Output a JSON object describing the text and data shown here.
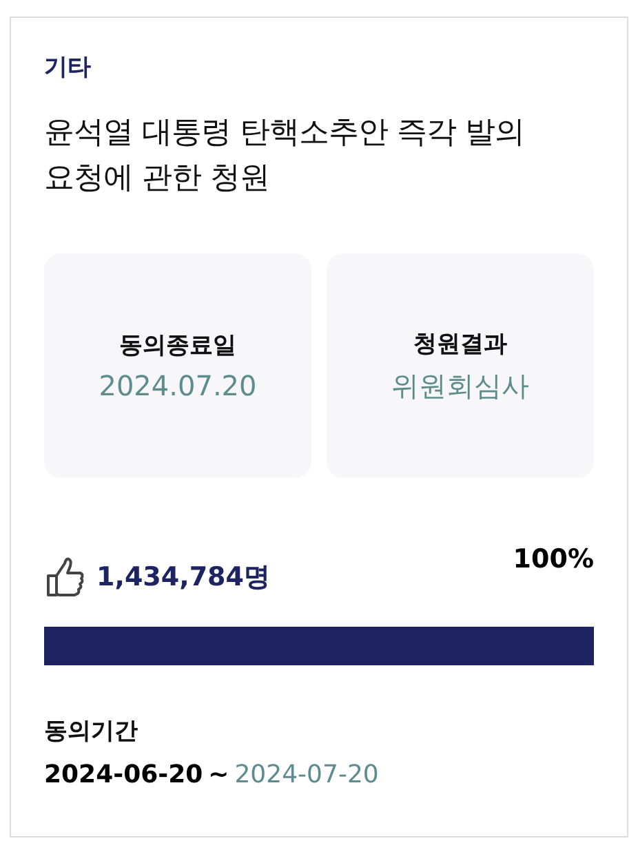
{
  "category": "기타",
  "title": "윤석열 대통령 탄핵소추안 즉각 발의 요청에 관한 청원",
  "info_boxes": [
    {
      "label": "동의종료일",
      "value": "2024.07.20"
    },
    {
      "label": "청원결과",
      "value": "위원회심사"
    }
  ],
  "votes": {
    "count": "1,434,784명",
    "percent": "100%",
    "level": 1
  },
  "period": {
    "label": "동의기간",
    "start": "2024-06-20",
    "separator": "~",
    "end": "2024-07-20"
  }
}
